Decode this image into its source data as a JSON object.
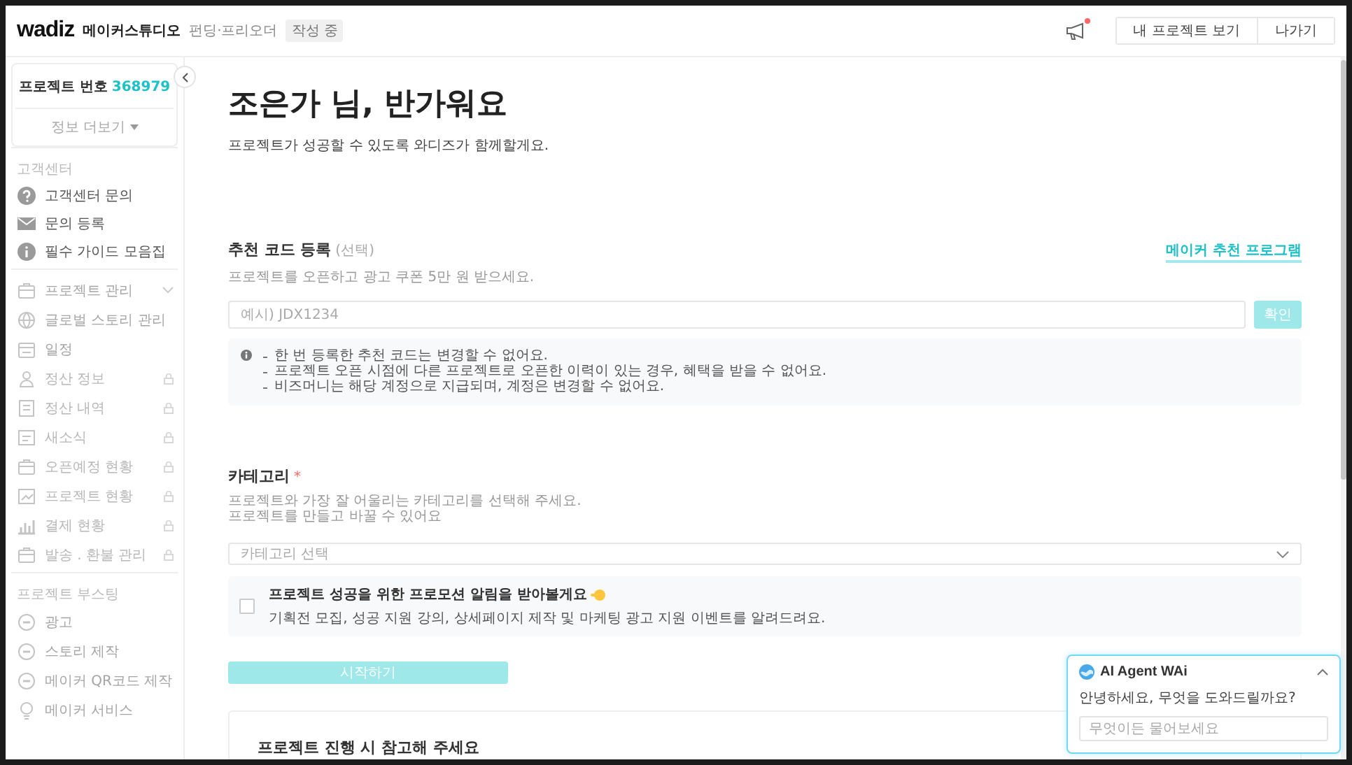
{
  "header": {
    "logo": "wadiz",
    "studio": "메이커스튜디오",
    "project_type": "펀딩·프리오더",
    "status_badge": "작성 중",
    "has_new_notice": true,
    "buttons": [
      "내 프로젝트 보기",
      "나가기"
    ]
  },
  "sidebar": {
    "project_label": "프로젝트 번호",
    "project_number": "368979",
    "more_info": "정보 더보기",
    "sections": [
      {
        "kind": "support",
        "title": "고객센터",
        "items": [
          {
            "label": "고객센터 문의",
            "kind": "link",
            "locked": false
          },
          {
            "label": "문의 등록",
            "kind": "link",
            "locked": false
          },
          {
            "label": "필수 가이드 모음집",
            "kind": "link",
            "locked": false
          }
        ]
      },
      {
        "kind": "menu",
        "items": [
          {
            "label": "프로젝트 관리",
            "kind": "group",
            "locked": false
          },
          {
            "label": "글로벌 스토리 관리",
            "kind": "link",
            "locked": false
          },
          {
            "label": "일정",
            "kind": "link",
            "locked": false
          },
          {
            "label": "정산 정보",
            "kind": "link",
            "locked": true
          },
          {
            "label": "정산 내역",
            "kind": "link",
            "locked": true
          },
          {
            "label": "새소식",
            "kind": "link",
            "locked": true
          },
          {
            "label": "오픈예정 현황",
            "kind": "link",
            "locked": true
          },
          {
            "label": "프로젝트 현황",
            "kind": "link",
            "locked": true
          },
          {
            "label": "결제 현황",
            "kind": "link",
            "locked": true
          },
          {
            "label": "발송 . 환불 관리",
            "kind": "link",
            "locked": true
          }
        ]
      },
      {
        "kind": "menu",
        "title": "프로젝트 부스팅",
        "items": [
          {
            "label": "광고",
            "kind": "link",
            "locked": false
          },
          {
            "label": "스토리 제작",
            "kind": "link",
            "locked": false
          },
          {
            "label": "메이커 QR코드 제작",
            "kind": "link",
            "locked": false
          },
          {
            "label": "메이커 서비스",
            "kind": "link",
            "locked": false
          }
        ]
      }
    ]
  },
  "main": {
    "greeting": "조은가 님, 반가워요",
    "subtitle": "프로젝트가 성공할 수 있도록 와디즈가 함께할게요.",
    "referral": {
      "title": "추천 코드 등록",
      "optional_mark": "(선택)",
      "link": "메이커 추천 프로그램",
      "description": "프로젝트를 오픈하고 광고 쿠폰 5만 원 받으세요.",
      "placeholder": "예시) JDX1234",
      "confirm_button": {
        "label": "확인",
        "disabled": true
      },
      "notices": [
        "한 번 등록한 추천 코드는 변경할 수 없어요.",
        "프로젝트 오픈 시점에 다른 프로젝트로 오픈한 이력이 있는 경우, 혜택을 받을 수 없어요.",
        "비즈머니는 해당 계정으로 지급되며, 계정은 변경할 수 없어요."
      ]
    },
    "category": {
      "title": "카테고리",
      "required_mark": "*",
      "description": [
        "프로젝트와 가장 잘 어울리는 카테고리를 선택해 주세요.",
        "프로젝트를 만들고 바꿀 수 있어요"
      ],
      "placeholder": "카테고리 선택",
      "promotion": {
        "checked": false,
        "title": "프로젝트 성공을 위한 프로모션 알림을 받아볼게요",
        "description": "기획전 모집, 성공 지원 강의, 상세페이지 제작 및 마케팅 광고 지원 이벤트를 알려드려요."
      }
    },
    "start_button": {
      "label": "시작하기",
      "disabled": true
    },
    "guide_card": {
      "title": "프로젝트 진행 시 참고해 주세요"
    }
  },
  "chat": {
    "title": "AI Agent WAi",
    "greeting": "안녕하세요, 무엇을 도와드릴까요?",
    "placeholder": "무엇이든 물어보세요"
  }
}
